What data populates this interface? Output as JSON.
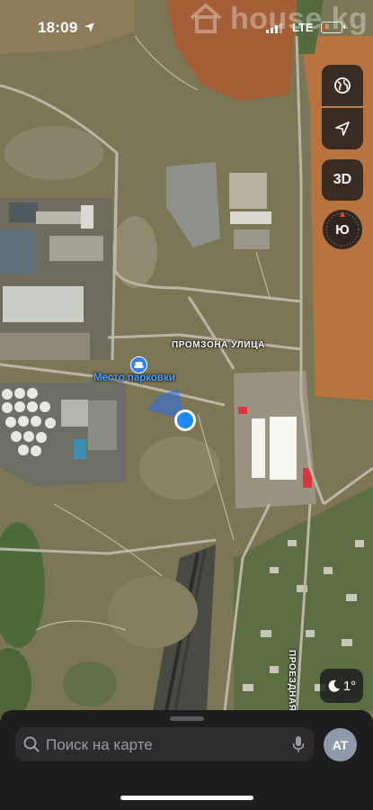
{
  "status_bar": {
    "time": "18:09",
    "network": "LTE",
    "watermark": "house.kg",
    "battery_level": 0.15,
    "battery_color": "#ff3b30"
  },
  "map": {
    "street_labels": [
      "ПРОМЗОНА УЛИЦА",
      "ПРОЕЗДНАЯ"
    ],
    "poi": {
      "name": "Место парковки",
      "icon": "parking-icon",
      "color": "#2f7ff6"
    },
    "user_location_color": "#1e88ff"
  },
  "controls": {
    "globe_icon": "globe-icon",
    "location_icon": "location-arrow-icon",
    "three_d_label": "3D",
    "compass_label": "Ю",
    "weather_icon": "moon-icon",
    "weather_temp": "1°"
  },
  "search": {
    "placeholder": "Поиск на карте",
    "mic_icon": "microphone-icon"
  },
  "account": {
    "initials": "AT"
  }
}
